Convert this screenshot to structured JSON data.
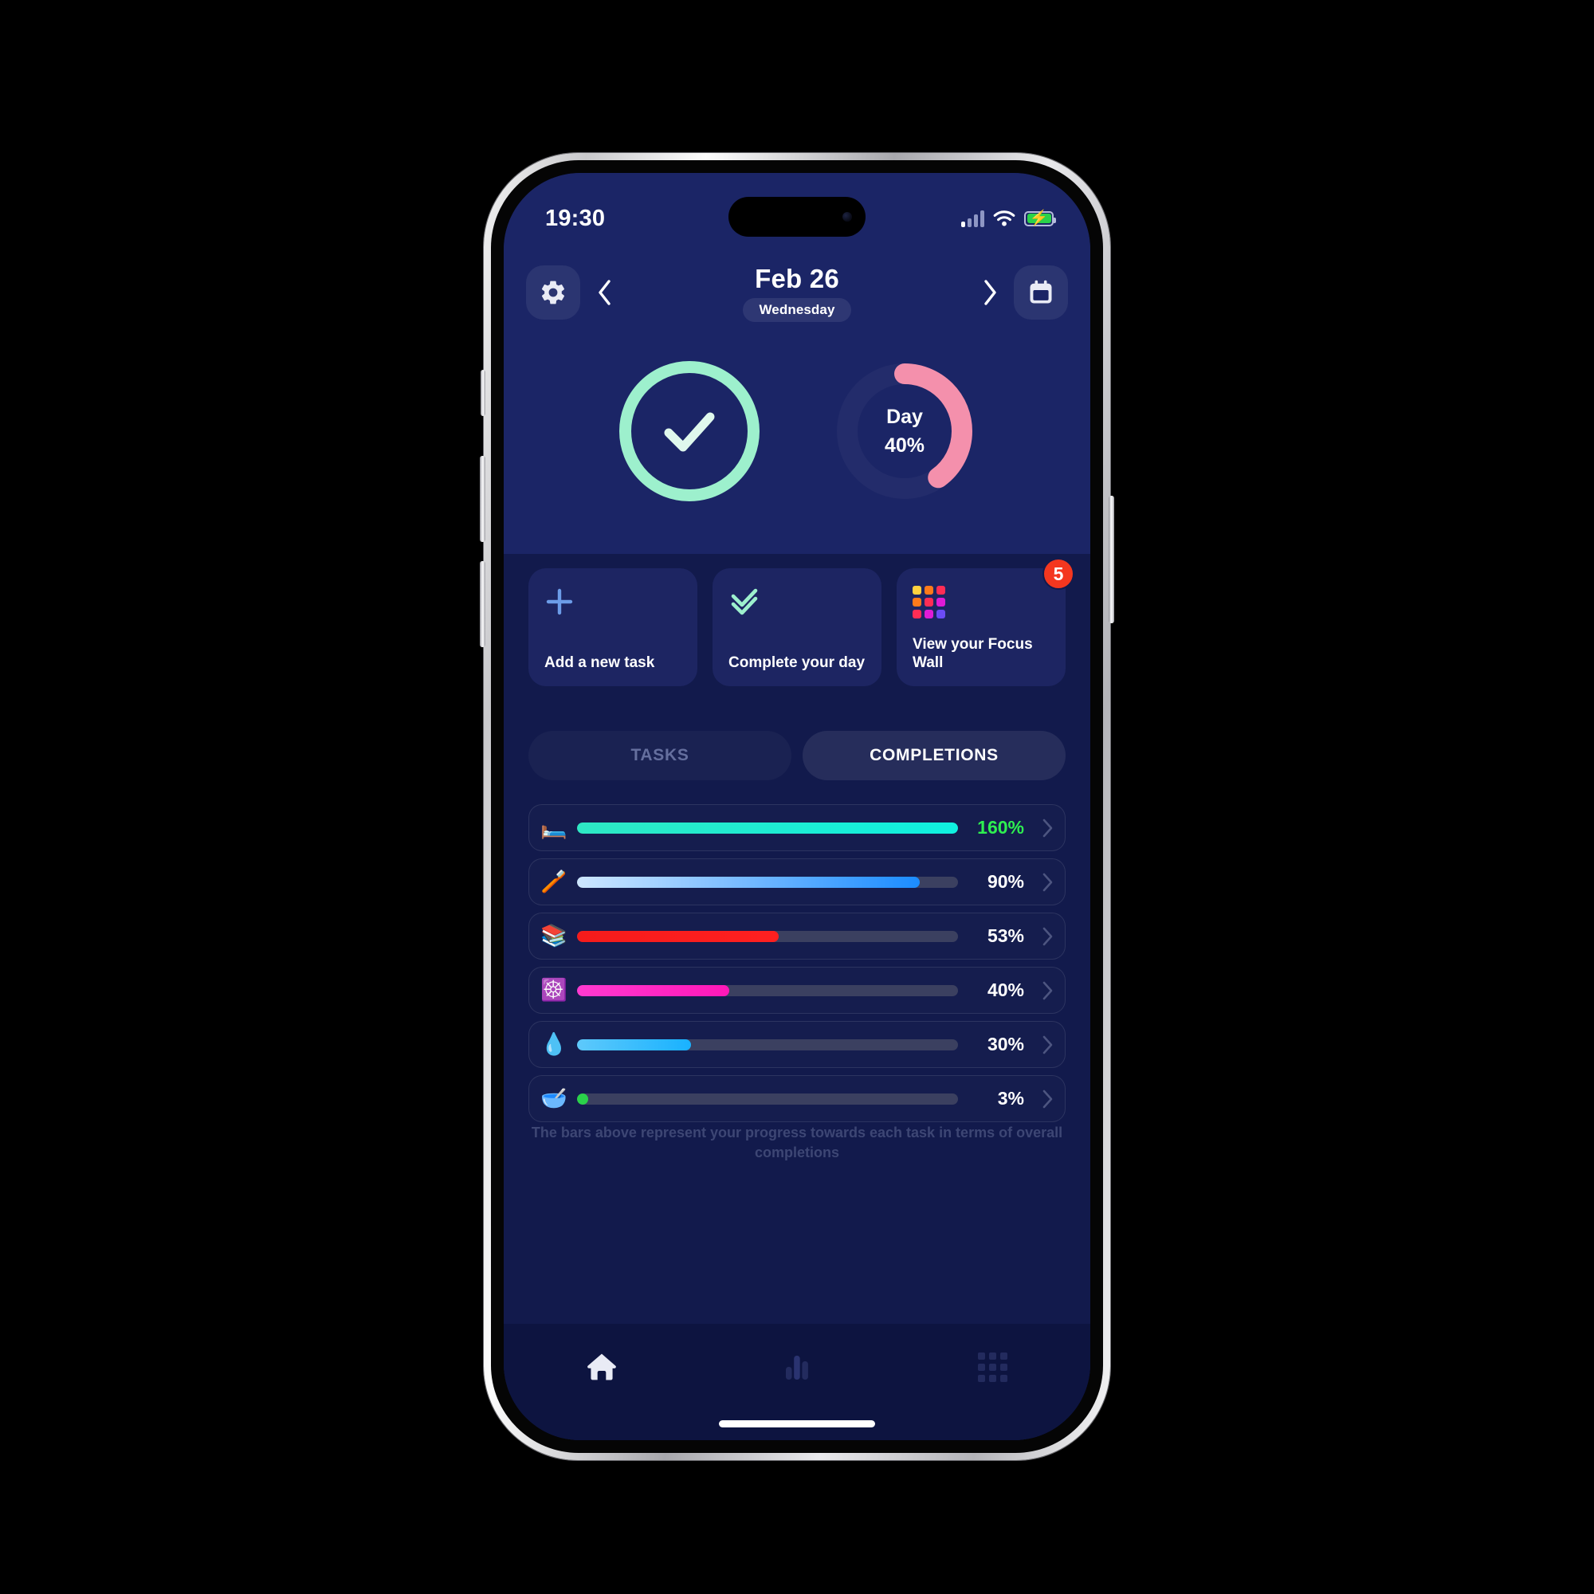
{
  "statusbar": {
    "time": "19:30",
    "signal_icon": "cellular-signal-icon",
    "wifi_icon": "wifi-icon",
    "battery_icon": "battery-charging-icon",
    "battery_bolt": "⚡"
  },
  "header": {
    "settings_icon": "gear-icon",
    "prev_icon": "chevron-left-icon",
    "next_icon": "chevron-right-icon",
    "calendar_icon": "calendar-icon",
    "date": "Feb 26",
    "weekday": "Wednesday"
  },
  "rings": {
    "check": {
      "icon": "check-circle-icon",
      "color": "#9df0cd"
    },
    "day": {
      "label": "Day",
      "value": "40%",
      "percent": 40,
      "color": "#f490ac",
      "track_color": "#232c6b"
    }
  },
  "cards": [
    {
      "icon": "plus-icon",
      "label": "Add a new task",
      "icon_color": "#6c9ce8",
      "badge": null
    },
    {
      "icon": "double-check-icon",
      "label": "Complete your day",
      "icon_color": "#9df0cd",
      "badge": null
    },
    {
      "icon": "grid-3x3-icon",
      "label": "View your Focus Wall",
      "icon_color": "#ff3b7b",
      "badge": "5",
      "grid_colors": [
        "#ffd23f",
        "#ff7a1a",
        "#ff2d55",
        "#ff7a1a",
        "#ff2d55",
        "#e01bd6",
        "#ff2d55",
        "#e01bd6",
        "#6b4cf6"
      ]
    }
  ],
  "tabs": [
    {
      "label": "TASKS",
      "active": false
    },
    {
      "label": "COMPLETIONS",
      "active": true
    }
  ],
  "chart_data": {
    "type": "bar",
    "title": "COMPLETIONS",
    "orientation": "horizontal",
    "xlabel": "",
    "ylabel": "",
    "xlim": [
      0,
      100
    ],
    "grid": false,
    "legend": false,
    "annotation": "The bars above represent your progress towards each task in terms of overall completions",
    "categories": [
      "bed",
      "toothbrush",
      "books",
      "dharma-wheel",
      "droplet",
      "bowl-with-spoon"
    ],
    "emojis": [
      "🛏️",
      "🪥",
      "📚",
      "☸️",
      "💧",
      "🥣"
    ],
    "values": [
      160,
      90,
      53,
      40,
      30,
      3
    ],
    "labels": [
      "160%",
      "90%",
      "53%",
      "40%",
      "30%",
      "3%"
    ],
    "bar_colors": [
      "#2ee8c4",
      "#cde6ff",
      "#f51b1b",
      "#ff3ad0",
      "#5ec9fb",
      "#2ad24a"
    ],
    "bar_colors_end": [
      "#0ff0e0",
      "#1b8cff",
      "#ff2020",
      "#ff18b8",
      "#19b2ff",
      "#2ad24a"
    ],
    "label_colors": [
      "#2ef050",
      "#ffffff",
      "#ffffff",
      "#ffffff",
      "#ffffff",
      "#ffffff"
    ],
    "track_color": "#3b4060"
  },
  "rows_meta": {
    "chevron_icon": "chevron-right-icon"
  },
  "footnote": "The bars above represent your progress towards each task in terms of overall completions",
  "bottomnav": [
    {
      "icon": "home-icon",
      "active": true
    },
    {
      "icon": "bar-chart-icon",
      "active": false
    },
    {
      "icon": "grid-icon",
      "active": false
    }
  ]
}
